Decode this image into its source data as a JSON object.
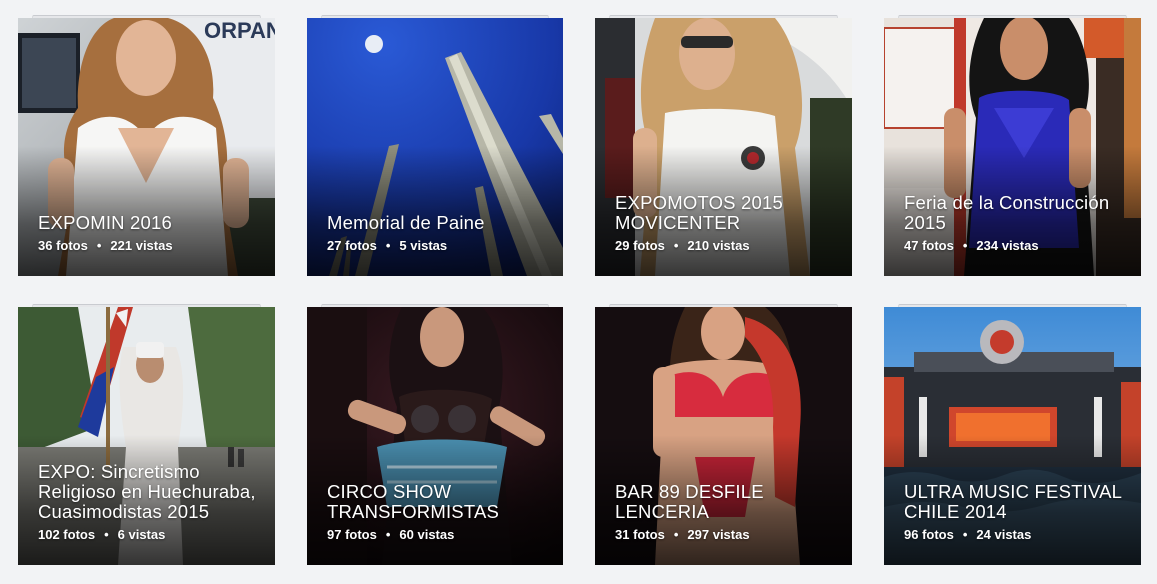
{
  "albums": [
    {
      "title": "EXPOMIN 2016",
      "photos": "36 fotos",
      "views": "221 vistas",
      "cover_text": "ORPAN LATINA SpA"
    },
    {
      "title": "Memorial de Paine",
      "photos": "27 fotos",
      "views": "5 vistas"
    },
    {
      "title": "EXPOMOTOS 2015 MOVICENTER",
      "photos": "29 fotos",
      "views": "210 vistas"
    },
    {
      "title": "Feria de la Construcción 2015",
      "photos": "47 fotos",
      "views": "234 vistas"
    },
    {
      "title": "EXPO: Sincretismo Religioso en Huechuraba, Cuasimodistas 2015",
      "photos": "102 fotos",
      "views": "6 vistas"
    },
    {
      "title": "CIRCO SHOW TRANSFORMISTAS",
      "photos": "97 fotos",
      "views": "60 vistas"
    },
    {
      "title": "BAR 89 DESFILE LENCERIA",
      "photos": "31 fotos",
      "views": "297 vistas"
    },
    {
      "title": "ULTRA MUSIC FESTIVAL CHILE 2014",
      "photos": "96 fotos",
      "views": "24 vistas"
    }
  ],
  "separator": "•",
  "colors": {
    "page_background": "#f2f3f5",
    "caption_text": "#ffffff"
  }
}
